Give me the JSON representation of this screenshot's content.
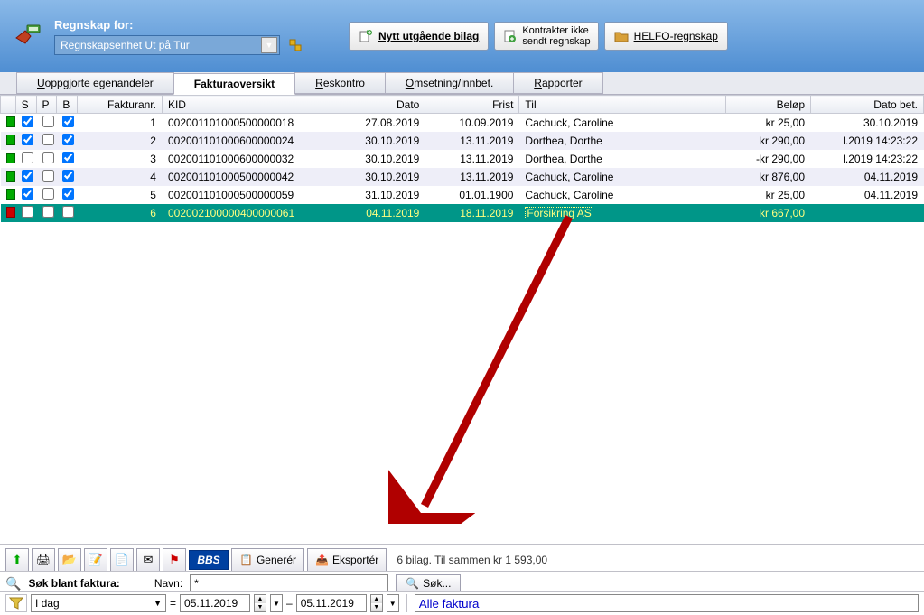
{
  "header": {
    "label": "Regnskap for:",
    "dropdown_value": "Regnskapsenhet Ut på Tur",
    "btn_nytt": "Nytt utgående bilag",
    "btn_kontrakter_l1": "Kontrakter ikke",
    "btn_kontrakter_l2": "sendt regnskap",
    "btn_helfo": "HELFO-regnskap"
  },
  "tabs": {
    "t1_pre": "U",
    "t1_rest": "oppgjorte egenandeler",
    "t2_pre": "F",
    "t2_rest": "akturaoversikt",
    "t3_pre": "R",
    "t3_rest": "eskontro",
    "t4_pre": "O",
    "t4_rest": "msetning/innbet.",
    "t5_pre": "R",
    "t5_rest": "apporter"
  },
  "cols": {
    "s": "S",
    "p": "P",
    "b": "B",
    "fn": "Fakturanr.",
    "kid": "KID",
    "dato": "Dato",
    "frist": "Frist",
    "til": "Til",
    "belop": "Beløp",
    "datobet": "Dato bet."
  },
  "rows": [
    {
      "status": "g",
      "s": true,
      "p": false,
      "b": true,
      "fn": "1",
      "kid": "002001101000500000018",
      "dato": "27.08.2019",
      "frist": "10.09.2019",
      "til": "Cachuck, Caroline",
      "belop": "kr 25,00",
      "datobet": "30.10.2019",
      "sel": false
    },
    {
      "status": "g",
      "s": true,
      "p": false,
      "b": true,
      "fn": "2",
      "kid": "002001101000600000024",
      "dato": "30.10.2019",
      "frist": "13.11.2019",
      "til": "Dorthea, Dorthe",
      "belop": "kr 290,00",
      "datobet": "l.2019 14:23:22",
      "sel": false
    },
    {
      "status": "g",
      "s": false,
      "p": false,
      "b": true,
      "fn": "3",
      "kid": "002001101000600000032",
      "dato": "30.10.2019",
      "frist": "13.11.2019",
      "til": "Dorthea, Dorthe",
      "belop": "-kr 290,00",
      "datobet": "l.2019 14:23:22",
      "sel": false
    },
    {
      "status": "g",
      "s": true,
      "p": false,
      "b": true,
      "fn": "4",
      "kid": "002001101000500000042",
      "dato": "30.10.2019",
      "frist": "13.11.2019",
      "til": "Cachuck, Caroline",
      "belop": "kr 876,00",
      "datobet": "04.11.2019",
      "sel": false
    },
    {
      "status": "g",
      "s": true,
      "p": false,
      "b": true,
      "fn": "5",
      "kid": "002001101000500000059",
      "dato": "31.10.2019",
      "frist": "01.01.1900",
      "til": "Cachuck, Caroline",
      "belop": "kr 25,00",
      "datobet": "04.11.2019",
      "sel": false
    },
    {
      "status": "r",
      "s": false,
      "p": false,
      "b": false,
      "fn": "6",
      "kid": "002002100000400000061",
      "dato": "04.11.2019",
      "frist": "18.11.2019",
      "til": "Forsikring AS",
      "belop": "kr 667,00",
      "datobet": "",
      "sel": true
    }
  ],
  "bottom": {
    "bbs": "BBS",
    "generer_pre": "G",
    "generer_rest": "enerér",
    "eksporter_pre": "E",
    "eksporter_rest": "ksportér",
    "summary": "6 bilag. Til sammen kr 1 593,00"
  },
  "search": {
    "title_pre": "S",
    "title_rest": "øk blant faktura:",
    "navn_label": "Navn:",
    "navn_value": "*",
    "sok_pre": "S",
    "sok_rest": "øk..."
  },
  "filter": {
    "period": "I dag",
    "eq": "=",
    "date_from": "05.11.2019",
    "dash": "–",
    "date_to": "05.11.2019",
    "text": "Alle faktura"
  }
}
